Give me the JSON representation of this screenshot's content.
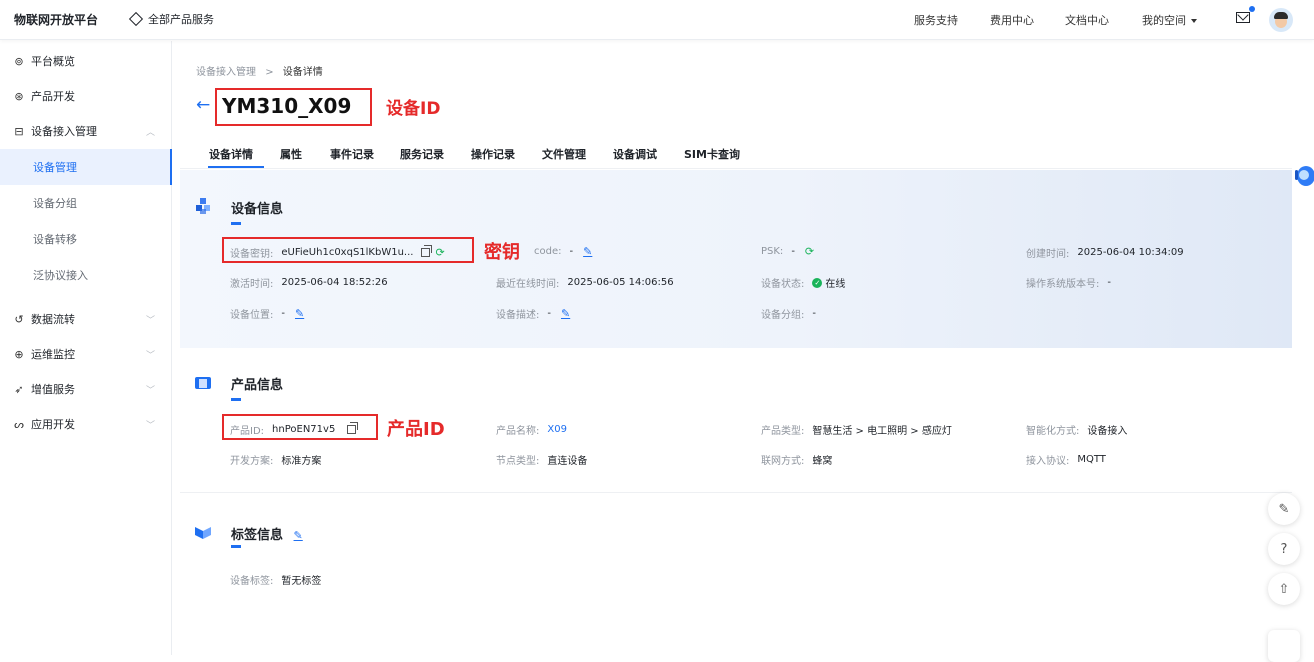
{
  "topbar": {
    "brand": "物联网开放平台",
    "all_products": "全部产品服务",
    "nav": [
      "服务支持",
      "费用中心",
      "文档中心",
      "我的空间"
    ]
  },
  "sidebar": {
    "items": [
      {
        "icon": "overview-icon",
        "label": "平台概览"
      },
      {
        "icon": "product-dev-icon",
        "label": "产品开发"
      },
      {
        "icon": "device-access-icon",
        "label": "设备接入管理"
      },
      {
        "icon": "data-flow-icon",
        "label": "数据流转"
      },
      {
        "icon": "ops-monitor-icon",
        "label": "运维监控"
      },
      {
        "icon": "value-added-icon",
        "label": "增值服务"
      },
      {
        "icon": "app-dev-icon",
        "label": "应用开发"
      }
    ],
    "sub_items": [
      "设备管理",
      "设备分组",
      "设备转移",
      "泛协议接入"
    ],
    "active_sub": "设备管理"
  },
  "breadcrumb": {
    "parent": "设备接入管理",
    "separator": ">",
    "current": "设备详情"
  },
  "device_title": "YM310_X09",
  "annotations": {
    "device_id": "设备ID",
    "secret": "密钥",
    "product_id": "产品ID"
  },
  "tabs": [
    "设备详情",
    "属性",
    "事件记录",
    "服务记录",
    "操作记录",
    "文件管理",
    "设备调试",
    "SIM卡查询"
  ],
  "device_info": {
    "title": "设备信息",
    "secret_label": "设备密钥:",
    "secret_value": "eUFieUh1c0xqS1lKbW1u...",
    "code_label": "code:",
    "code_value": "-",
    "psk_label": "PSK:",
    "psk_value": "-",
    "created_label": "创建时间:",
    "created_value": "2025-06-04 10:34:09",
    "activated_label": "激活时间:",
    "activated_value": "2025-06-04 18:52:26",
    "last_online_label": "最近在线时间:",
    "last_online_value": "2025-06-05 14:06:56",
    "status_label": "设备状态:",
    "status_value": "在线",
    "os_label": "操作系统版本号:",
    "os_value": "-",
    "location_label": "设备位置:",
    "location_value": "-",
    "desc_label": "设备描述:",
    "desc_value": "-",
    "group_label": "设备分组:",
    "group_value": "-"
  },
  "product_info": {
    "title": "产品信息",
    "pid_label": "产品ID:",
    "pid_value": "hnPoEN71v5",
    "name_label": "产品名称:",
    "name_value": "X09",
    "type_label": "产品类型:",
    "type_value": "智慧生活 > 电工照明 > 感应灯",
    "smart_label": "智能化方式:",
    "smart_value": "设备接入",
    "dev_label": "开发方案:",
    "dev_value": "标准方案",
    "node_label": "节点类型:",
    "node_value": "直连设备",
    "net_label": "联网方式:",
    "net_value": "蜂窝",
    "protocol_label": "接入协议:",
    "protocol_value": "MQTT"
  },
  "tag_info": {
    "title": "标签信息",
    "tag_label": "设备标签:",
    "tag_value": "暂无标签"
  },
  "colors": {
    "accent": "#1e6ff1",
    "annotation_red": "#e52a2a",
    "online": "#19b35a"
  }
}
